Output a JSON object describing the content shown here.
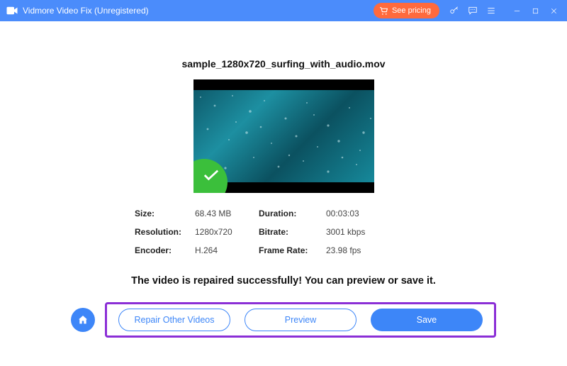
{
  "titlebar": {
    "app_title": "Vidmore Video Fix (Unregistered)",
    "see_pricing": "See pricing"
  },
  "file": {
    "name": "sample_1280x720_surfing_with_audio.mov"
  },
  "meta": {
    "size_label": "Size:",
    "size": "68.43 MB",
    "duration_label": "Duration:",
    "duration": "00:03:03",
    "resolution_label": "Resolution:",
    "resolution": "1280x720",
    "bitrate_label": "Bitrate:",
    "bitrate": "3001 kbps",
    "encoder_label": "Encoder:",
    "encoder": "H.264",
    "framerate_label": "Frame Rate:",
    "framerate": "23.98 fps"
  },
  "message": "The video is repaired successfully! You can preview or save it.",
  "buttons": {
    "repair_other": "Repair Other Videos",
    "preview": "Preview",
    "save": "Save"
  }
}
